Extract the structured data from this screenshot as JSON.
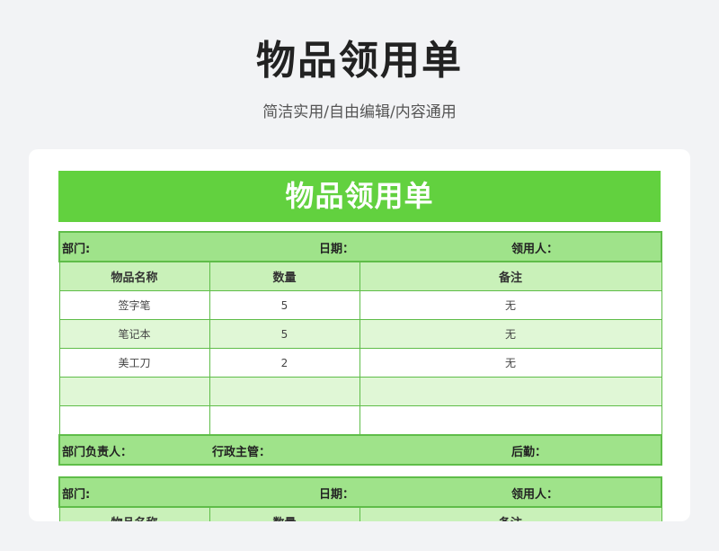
{
  "page": {
    "title": "物品领用单",
    "subtitle": "简洁实用/自由编辑/内容通用"
  },
  "form": {
    "banner_title": "物品领用单",
    "info": {
      "department": "部门:",
      "date": "日期：",
      "recipient": "领用人："
    },
    "columns": [
      "物品名称",
      "数量",
      "备注"
    ],
    "rows": [
      {
        "name": "签字笔",
        "qty": "5",
        "note": "无"
      },
      {
        "name": "笔记本",
        "qty": "5",
        "note": "无"
      },
      {
        "name": "美工刀",
        "qty": "2",
        "note": "无"
      },
      {
        "name": "",
        "qty": "",
        "note": ""
      },
      {
        "name": "",
        "qty": "",
        "note": ""
      }
    ],
    "footer": {
      "dept_head": "部门负责人：",
      "admin_head": "行政主管：",
      "logistics": "后勤："
    }
  },
  "form2": {
    "info": {
      "department": "部门:",
      "date": "日期：",
      "recipient": "领用人："
    },
    "columns": [
      "物品名称",
      "数量",
      "备注"
    ]
  }
}
